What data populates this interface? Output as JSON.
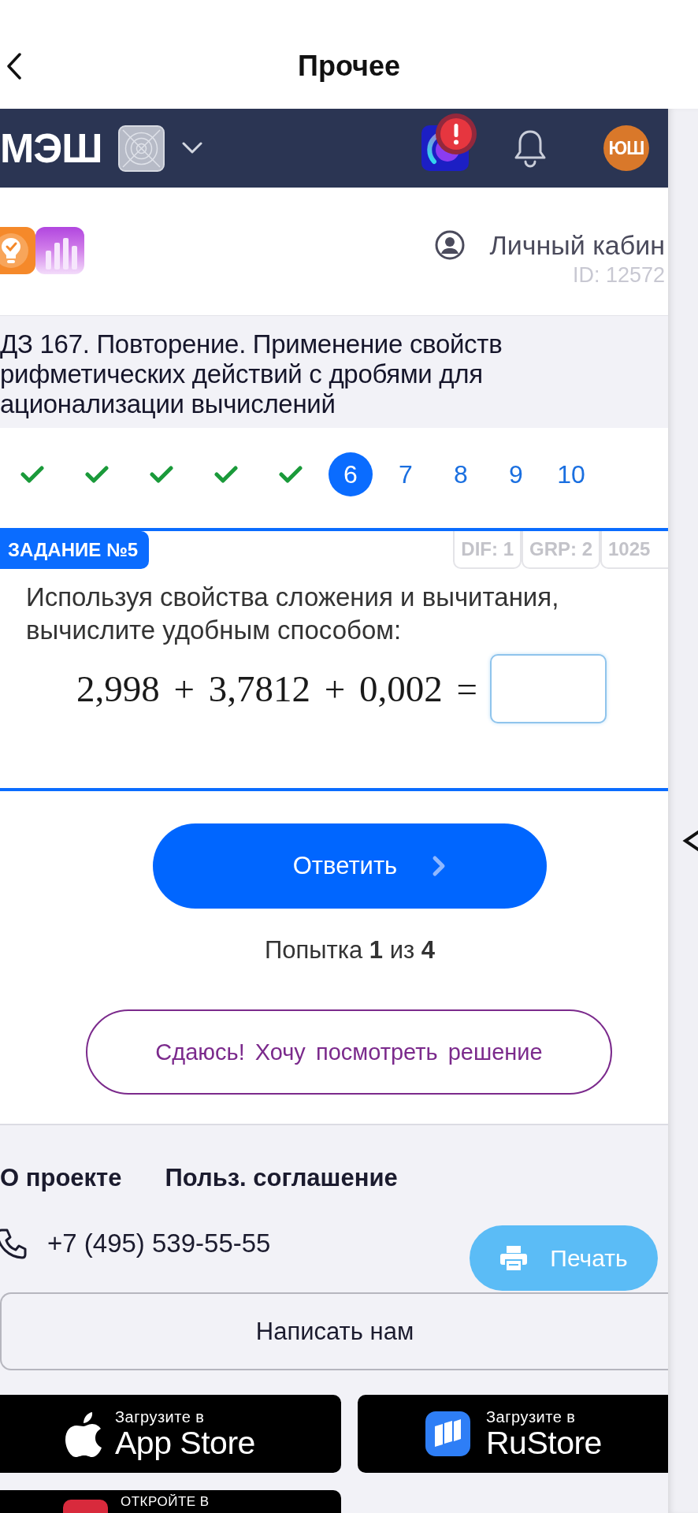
{
  "nav_bar": {
    "title": "Прочее"
  },
  "app_header": {
    "logo": "МЭШ",
    "avatar_initials": "ЮШ"
  },
  "profile_bar": {
    "account_link": "Личный кабин",
    "user_id": "ID: 12572"
  },
  "lesson": {
    "title_lines": [
      "ДЗ 167. Повторение. Применение свойств",
      "рифметических действий с дробями для",
      "ационализации вычислений"
    ]
  },
  "task_tabs": [
    {
      "kind": "done",
      "selected": false
    },
    {
      "kind": "done",
      "selected": false
    },
    {
      "kind": "done",
      "selected": false
    },
    {
      "kind": "done",
      "selected": false
    },
    {
      "kind": "done",
      "selected": false
    },
    {
      "kind": "number",
      "label": "6",
      "selected": true
    },
    {
      "kind": "number",
      "label": "7",
      "selected": false
    },
    {
      "kind": "number",
      "label": "8",
      "selected": false
    },
    {
      "kind": "number",
      "label": "9",
      "selected": false
    },
    {
      "kind": "number",
      "label": "10",
      "selected": false
    }
  ],
  "task": {
    "tag": "ЗАДАНИЕ №5",
    "meta": [
      "DIF: 1",
      "GRP: 2",
      "1025"
    ],
    "question": "Используя свойства сложения и вычитания, вычислите удобным способом:",
    "expression": "2,998 + 3,7812 + 0,002 ="
  },
  "answer_button": "Ответить",
  "attempt": "Попытка **1** из **4**",
  "give_up_button": "Сдаюсь! Хочу посмотреть решение",
  "footer": {
    "links": [
      "О проекте",
      "Польз. соглашение"
    ],
    "phone": "+7 (495) 539-55-55",
    "print_button": "Печать",
    "contact_button": "Написать нам",
    "stores": [
      {
        "kind": "appstore",
        "caption": "Загрузите в",
        "name": "App Store"
      },
      {
        "kind": "rustore",
        "caption": "Загрузите в",
        "name": "RuStore"
      },
      {
        "kind": "other",
        "caption": "ОТКРОЙТЕ В"
      }
    ]
  }
}
